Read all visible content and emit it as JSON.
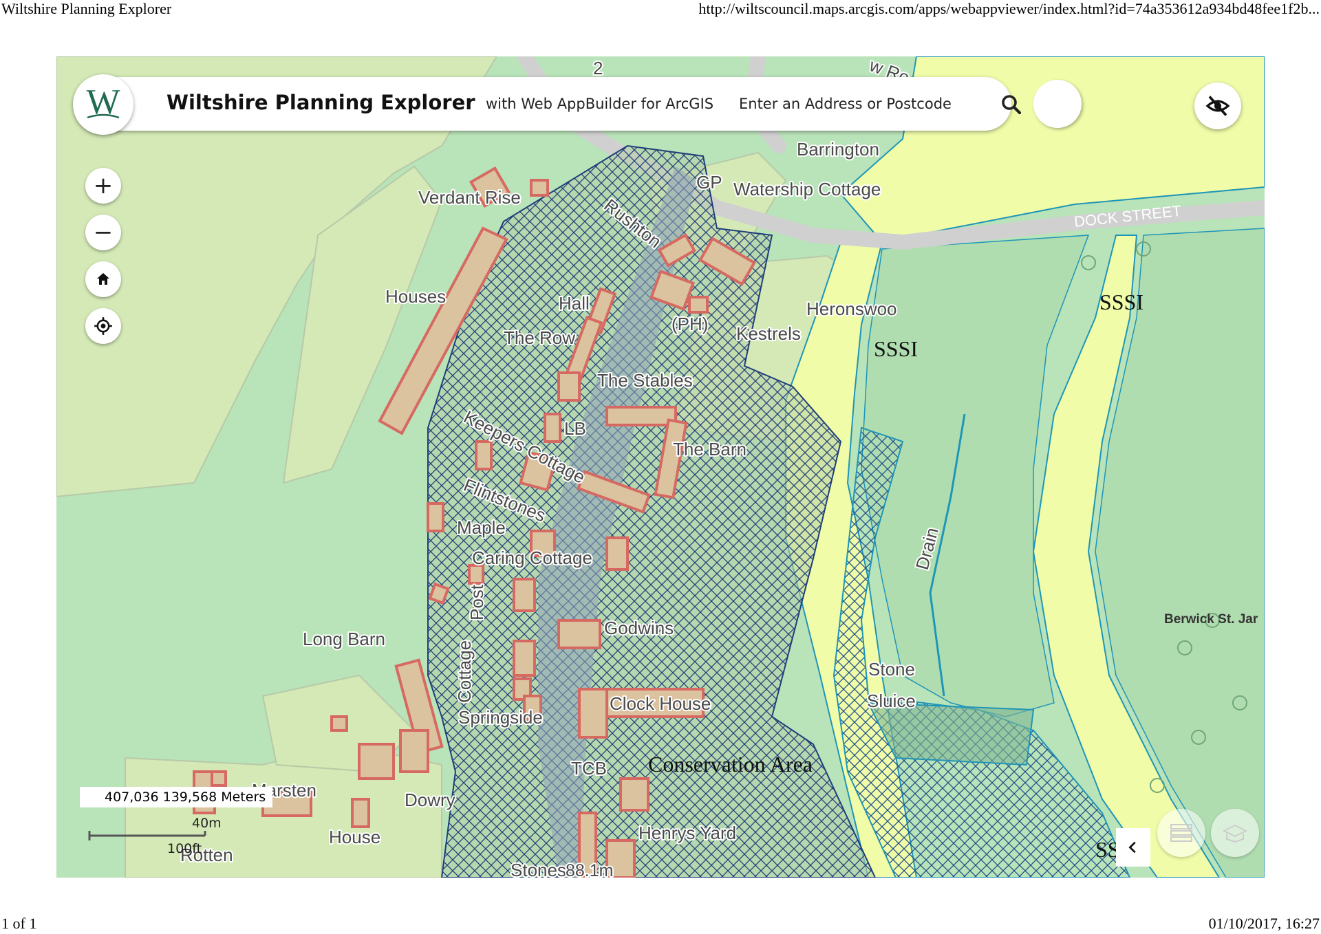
{
  "print": {
    "title": "Wiltshire Planning Explorer",
    "url": "http://wiltscouncil.maps.arcgis.com/apps/webappviewer/index.html?id=74a353612a934bd48fee1f2b...",
    "page": "1 of 1",
    "datetime": "01/10/2017, 16:27"
  },
  "header": {
    "logo_letter": "W",
    "title": "Wiltshire Planning Explorer",
    "subtitle": "with Web AppBuilder for ArcGIS",
    "search_placeholder": "Enter an Address or Postcode"
  },
  "controls": {
    "zoom_in": "+",
    "zoom_out": "−",
    "home": "home-icon",
    "locate": "locate-icon",
    "visibility": "eye-off-icon",
    "panel": "chevron-left-icon",
    "widgets": [
      "layer-list-icon",
      "basemap-icon"
    ]
  },
  "status": {
    "coordinates": "407,036 139,568 Meters",
    "scale_metric": "40m",
    "scale_imperial": "100ft"
  },
  "map": {
    "colors": {
      "background": "#b9e3b9",
      "parcel": "#d6e8b8",
      "sssi": "#f0fca8",
      "building_fill": "#dcc3a0",
      "building_stroke": "#d66a62",
      "hatch": "#1f3f7a",
      "boundary": "#1f95b8"
    },
    "labels": {
      "verdant_rise": "Verdant Rise",
      "houses": "Houses",
      "hall": "Hall",
      "the_row": "The Row",
      "rushton": "Rushton",
      "gp": "GP",
      "watership": "Watership Cottage",
      "barrington": "Barrington",
      "ph": "(PH)",
      "kestrels": "Kestrels",
      "heronswood": "Heronswoo",
      "the_stables": "The Stables",
      "lb": "LB",
      "keepers": "Keepers Cottage",
      "the_barn": "The Barn",
      "flintstones": "Flintstones",
      "maple": "Maple",
      "caring": "Caring Cottage",
      "post": "Post",
      "cottage_v": "Cottage",
      "godwins": "Godwins",
      "long_barn": "Long Barn",
      "clock_house": "Clock House",
      "springside": "Springside",
      "tcb": "TCB",
      "conservation": "Conservation Area",
      "marsten": "Marsten",
      "dowry": "Dowry",
      "house": "House",
      "rotten": "Rotten",
      "henrys_yard": "Henrys Yard",
      "stones": "Stones",
      "elev": "88.1m",
      "drain": "Drain",
      "stone": "Stone",
      "sluice": "Sluice",
      "sssi_a": "SSSI",
      "sssi_b": "SSSI",
      "sssi_c": "SS",
      "berwick": "Berwick St. Jar",
      "road_top": "w Ro",
      "dock_street": "DOCK STREET",
      "num_2": "2"
    }
  }
}
